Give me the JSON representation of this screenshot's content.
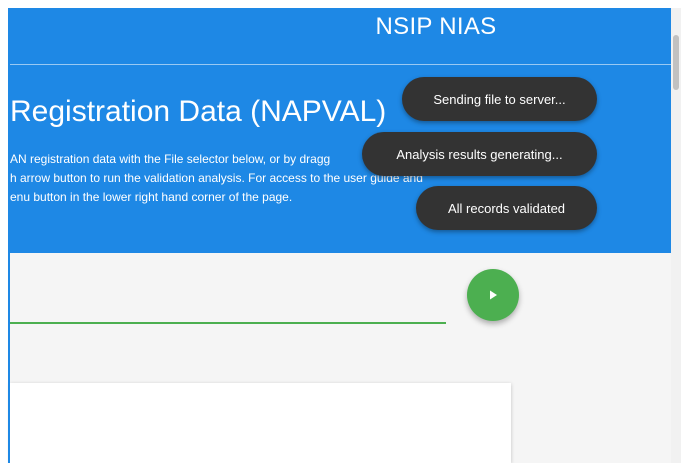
{
  "header": {
    "title": "NSIP NIAS"
  },
  "banner": {
    "title": "Registration Data (NAPVAL)",
    "description_lines": [
      "AN registration data with the File selector below, or by dragg",
      "h arrow button to run the validation analysis. For access to the user guide and",
      "enu button in the lower right hand corner of the page."
    ]
  },
  "run_button": {
    "icon": "play-icon"
  },
  "toasts": [
    "Sending file to server...",
    "Analysis results generating...",
    "All records validated"
  ],
  "colors": {
    "primary": "#1e88e5",
    "accent": "#4caf50",
    "toast_background": "#333333",
    "content_background": "#f5f5f5"
  }
}
